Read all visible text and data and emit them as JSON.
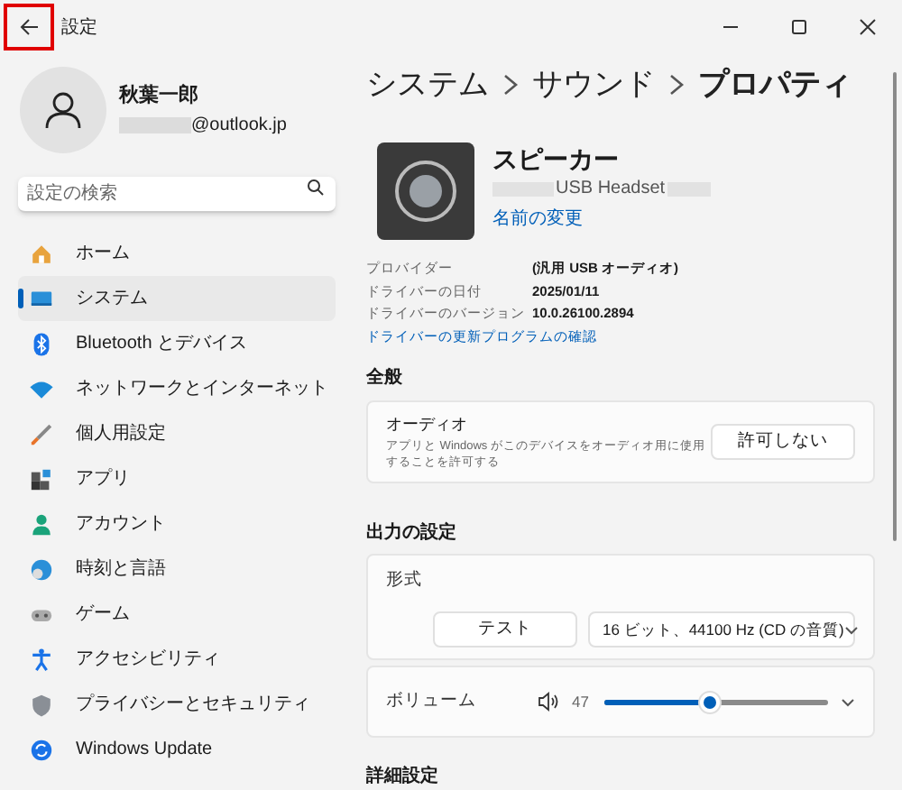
{
  "window": {
    "title": "設定"
  },
  "account": {
    "name": "秋葉一郎",
    "email": "@outlook.jp"
  },
  "search": {
    "placeholder": "設定の検索"
  },
  "sidebar": {
    "items": [
      {
        "label": "ホーム",
        "selected": false
      },
      {
        "label": "システム",
        "selected": true
      },
      {
        "label": "Bluetooth とデバイス",
        "selected": false
      },
      {
        "label": "ネットワークとインターネット",
        "selected": false
      },
      {
        "label": "個人用設定",
        "selected": false
      },
      {
        "label": "アプリ",
        "selected": false
      },
      {
        "label": "アカウント",
        "selected": false
      },
      {
        "label": "時刻と言語",
        "selected": false
      },
      {
        "label": "ゲーム",
        "selected": false
      },
      {
        "label": "アクセシビリティ",
        "selected": false
      },
      {
        "label": "プライバシーとセキュリティ",
        "selected": false
      },
      {
        "label": "Windows Update",
        "selected": false
      }
    ]
  },
  "breadcrumb": [
    "システム",
    "サウンド",
    "プロパティ"
  ],
  "device": {
    "name": "スピーカー",
    "model": "USB Headset",
    "rename_link": "名前の変更"
  },
  "properties": [
    {
      "label": "プロバイダー",
      "value": "(汎用 USB オーディオ)"
    },
    {
      "label": "ドライバーの日付",
      "value": "2025/01/11"
    },
    {
      "label": "ドライバーのバージョン",
      "value": "10.0.26100.2894"
    }
  ],
  "driver_link": "ドライバーの更新プログラムの確認",
  "general": {
    "heading": "全般",
    "title": "オーディオ",
    "description": "アプリと Windows がこのデバイスをオーディオ用に使用することを許可する",
    "button": "許可しない"
  },
  "output": {
    "heading": "出力の設定",
    "format_label": "形式",
    "test_button": "テスト",
    "format_value": "16 ビット、44100 Hz (CD の音質)",
    "volume_label": "ボリューム",
    "volume_reading": "47",
    "level": 0.47
  },
  "next_heading": "詳細設定"
}
